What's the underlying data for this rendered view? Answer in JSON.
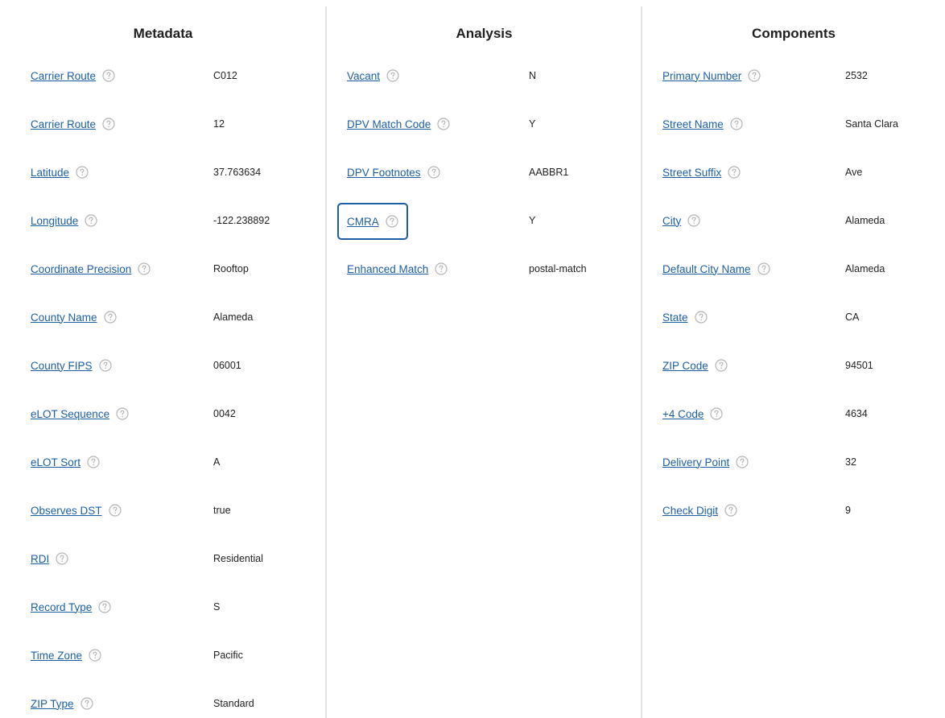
{
  "metadata": {
    "title": "Metadata",
    "rows": [
      {
        "label": "Carrier Route",
        "value": "C012"
      },
      {
        "label": "Carrier Route",
        "value": "12"
      },
      {
        "label": "Latitude",
        "value": "37.763634"
      },
      {
        "label": "Longitude",
        "value": "-122.238892"
      },
      {
        "label": "Coordinate Precision",
        "value": "Rooftop"
      },
      {
        "label": "County Name",
        "value": "Alameda"
      },
      {
        "label": "County FIPS",
        "value": "06001"
      },
      {
        "label": "eLOT Sequence",
        "value": "0042"
      },
      {
        "label": "eLOT Sort",
        "value": "A"
      },
      {
        "label": "Observes DST",
        "value": "true"
      },
      {
        "label": "RDI",
        "value": "Residential"
      },
      {
        "label": "Record Type",
        "value": "S"
      },
      {
        "label": "Time Zone",
        "value": "Pacific"
      },
      {
        "label": "ZIP Type",
        "value": "Standard"
      }
    ]
  },
  "analysis": {
    "title": "Analysis",
    "rows": [
      {
        "label": "Vacant",
        "value": "N"
      },
      {
        "label": "DPV Match Code",
        "value": "Y"
      },
      {
        "label": "DPV Footnotes",
        "value": "AABBR1"
      },
      {
        "label": "CMRA",
        "value": "Y",
        "focused": true
      },
      {
        "label": "Enhanced Match",
        "value": "postal-match"
      }
    ]
  },
  "components": {
    "title": "Components",
    "rows": [
      {
        "label": "Primary Number",
        "value": "2532"
      },
      {
        "label": "Street Name",
        "value": "Santa Clara"
      },
      {
        "label": "Street Suffix",
        "value": "Ave"
      },
      {
        "label": "City",
        "value": "Alameda"
      },
      {
        "label": "Default City Name",
        "value": "Alameda"
      },
      {
        "label": "State",
        "value": "CA"
      },
      {
        "label": "ZIP Code",
        "value": "94501"
      },
      {
        "label": "+4 Code",
        "value": "4634"
      },
      {
        "label": "Delivery Point",
        "value": "32"
      },
      {
        "label": "Check Digit",
        "value": "9"
      }
    ]
  },
  "icons": {
    "help": "question-circle-icon"
  },
  "colors": {
    "link": "#1d5fa6",
    "divider": "#e3e3e3",
    "icon": "#b5b5b5",
    "text": "#222222"
  }
}
